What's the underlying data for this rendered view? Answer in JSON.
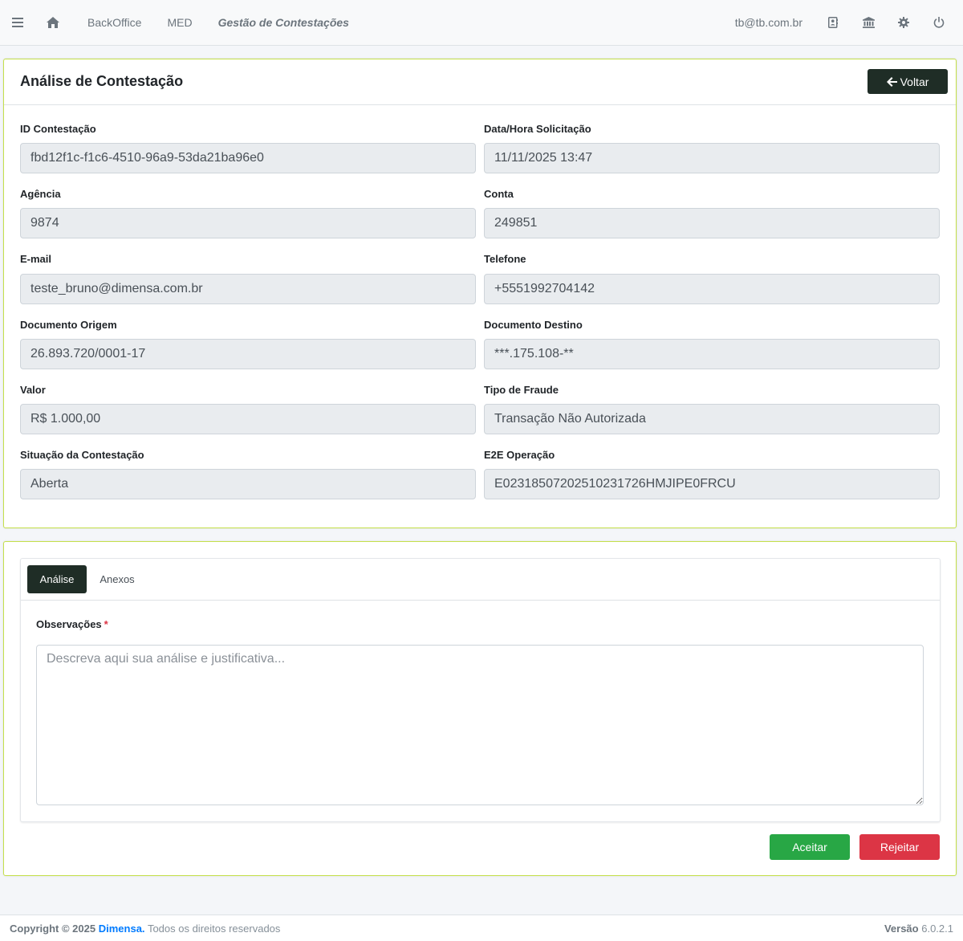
{
  "navbar": {
    "menu_icon": "hamburger-icon",
    "home_icon": "home-icon",
    "links": [
      "BackOffice",
      "MED"
    ],
    "current": "Gestão de Contestações",
    "user": "tb@tb.com.br",
    "icons": [
      "contact-book-icon",
      "bank-icon",
      "gear-icon",
      "power-icon"
    ]
  },
  "card": {
    "title": "Análise de Contestação",
    "back_label": "Voltar",
    "fields": [
      {
        "label": "ID Contestação",
        "value": "fbd12f1c-f1c6-4510-96a9-53da21ba96e0"
      },
      {
        "label": "Data/Hora Solicitação",
        "value": "11/11/2025 13:47"
      },
      {
        "label": "Agência",
        "value": "9874"
      },
      {
        "label": "Conta",
        "value": "249851"
      },
      {
        "label": "E-mail",
        "value": "teste_bruno@dimensa.com.br"
      },
      {
        "label": "Telefone",
        "value": "+5551992704142"
      },
      {
        "label": "Documento Origem",
        "value": "26.893.720/0001-17"
      },
      {
        "label": "Documento Destino",
        "value": "***.175.108-**"
      },
      {
        "label": "Valor",
        "value": "R$ 1.000,00"
      },
      {
        "label": "Tipo de Fraude",
        "value": "Transação Não Autorizada"
      },
      {
        "label": "Situação da Contestação",
        "value": "Aberta"
      },
      {
        "label": "E2E Operação",
        "value": "E02318507202510231726HMJIPE0FRCU"
      }
    ]
  },
  "analysis": {
    "tabs": [
      "Análise",
      "Anexos"
    ],
    "obs_label": "Observações",
    "obs_required": "*",
    "obs_placeholder": "Descreva aqui sua análise e justificativa...",
    "obs_value": "",
    "accept_label": "Aceitar",
    "reject_label": "Rejeitar"
  },
  "footer": {
    "copyright": "Copyright © 2025",
    "brand": "Dimensa.",
    "rights": "Todos os direitos reservados",
    "version_label": "Versão",
    "version": "6.0.2.1"
  },
  "colors": {
    "accent_border": "#c5e04a",
    "dark_button": "#1f2d26",
    "success": "#28a745",
    "danger": "#dc3545",
    "brand": "#007bff"
  }
}
